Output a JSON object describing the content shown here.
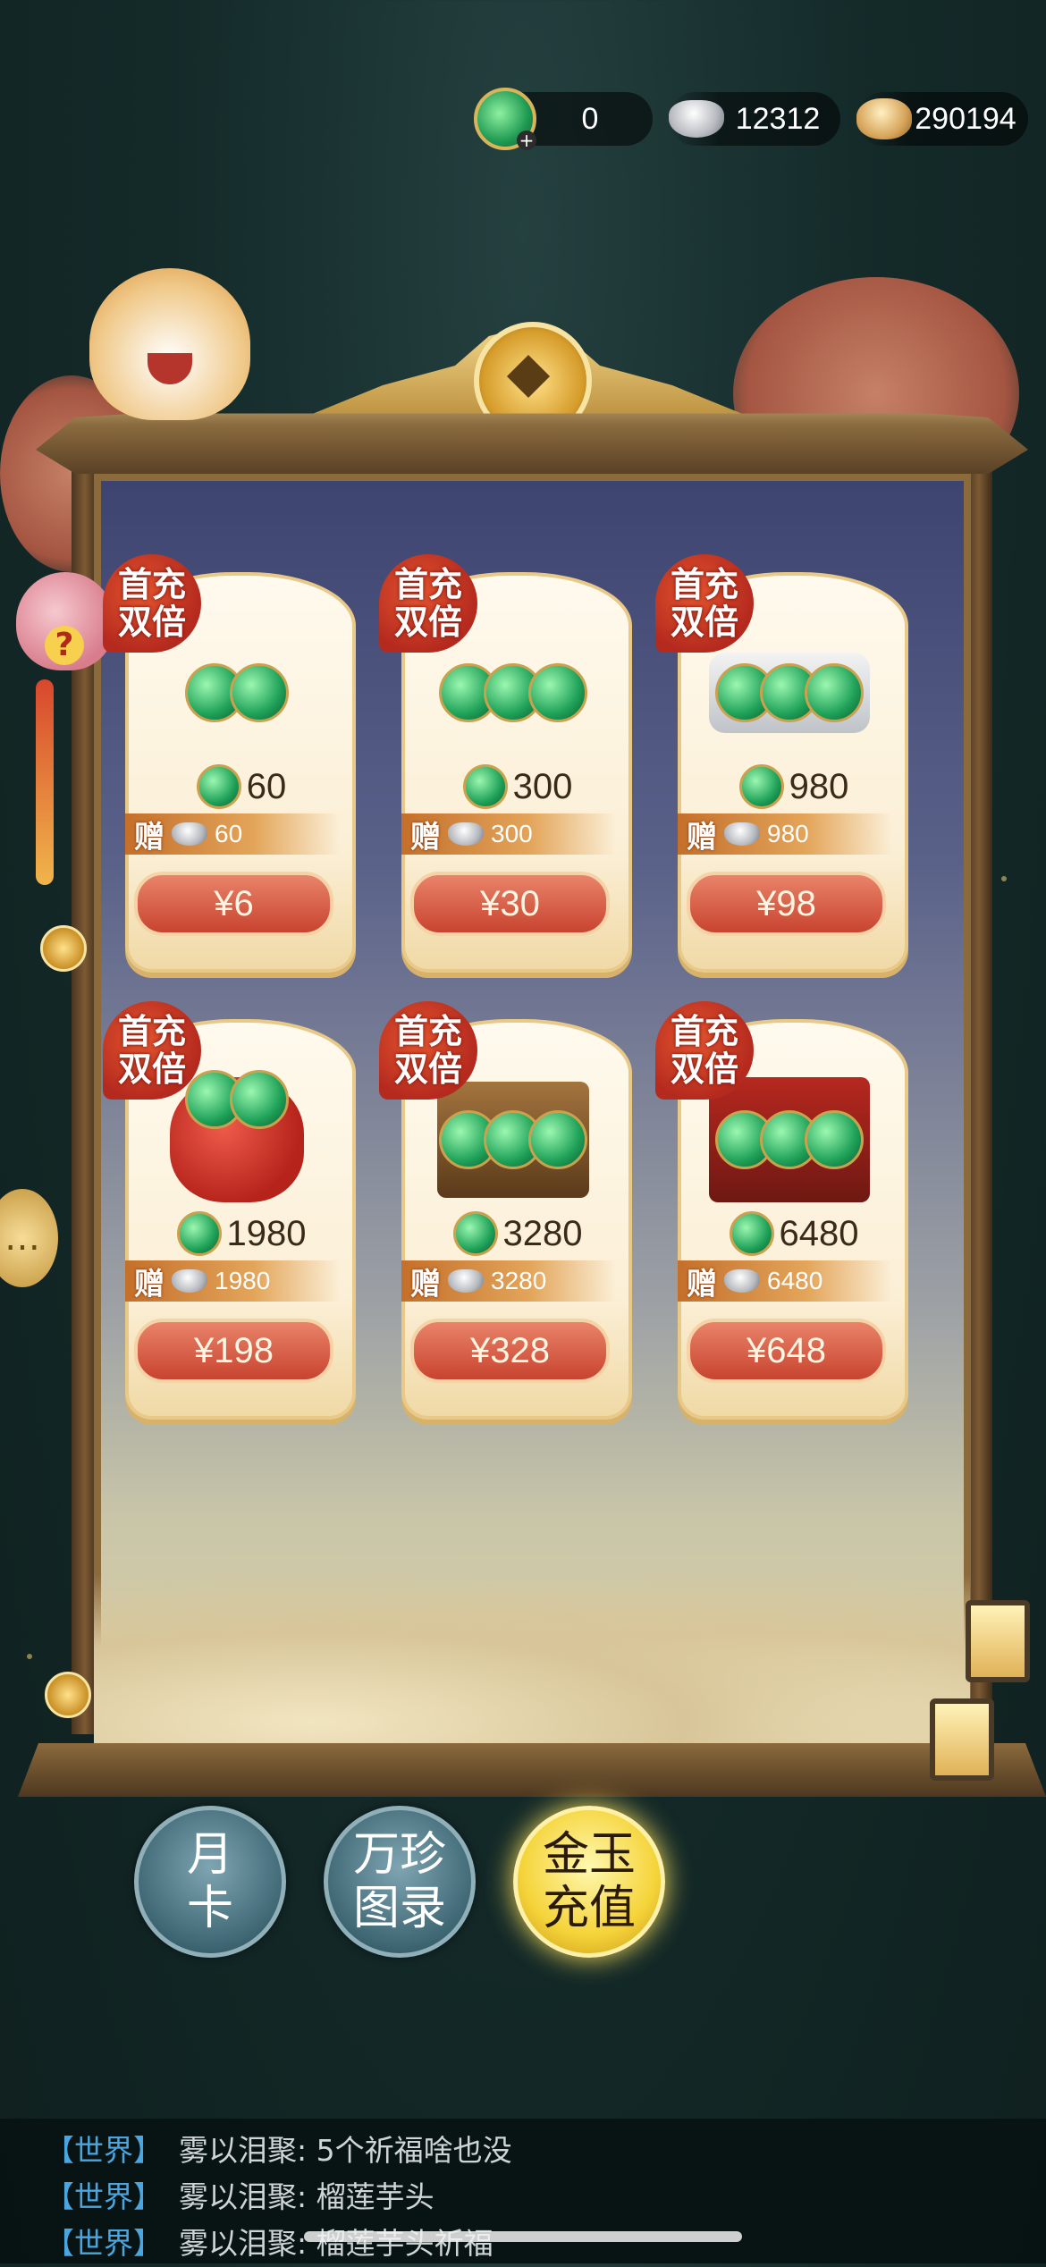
{
  "currencies": [
    {
      "icon": "jade-coin-icon",
      "value": "0",
      "has_plus": true
    },
    {
      "icon": "silver-ingot-icon",
      "value": "12312"
    },
    {
      "icon": "copper-coins-icon",
      "value": "290194"
    }
  ],
  "products": [
    {
      "badge": [
        "首充",
        "双倍"
      ],
      "art": "jade-pile-small-icon",
      "amount": "60",
      "bonus_label": "赠",
      "bonus": "60",
      "price": "¥6"
    },
    {
      "badge": [
        "首充",
        "双倍"
      ],
      "art": "jade-pile-medium-icon",
      "amount": "300",
      "bonus_label": "赠",
      "bonus": "300",
      "price": "¥30"
    },
    {
      "badge": [
        "首充",
        "双倍"
      ],
      "art": "jade-tray-icon",
      "amount": "980",
      "bonus_label": "赠",
      "bonus": "980",
      "price": "¥98"
    },
    {
      "badge": [
        "首充",
        "双倍"
      ],
      "art": "jade-bag-icon",
      "amount": "1980",
      "bonus_label": "赠",
      "bonus": "1980",
      "price": "¥198"
    },
    {
      "badge": [
        "首充",
        "双倍"
      ],
      "art": "jade-basket-icon",
      "amount": "3280",
      "bonus_label": "赠",
      "bonus": "3280",
      "price": "¥328"
    },
    {
      "badge": [
        "首充",
        "双倍"
      ],
      "art": "jade-chest-icon",
      "amount": "6480",
      "bonus_label": "赠",
      "bonus": "6480",
      "price": "¥648"
    }
  ],
  "tabs": [
    {
      "label": "月\n卡",
      "active": false
    },
    {
      "label": "万珍\n图录",
      "active": false
    },
    {
      "label": "金玉\n充值",
      "active": true
    }
  ],
  "chat": [
    {
      "channel": "【世界】",
      "text": "雾以泪聚: 5个祈福啥也没"
    },
    {
      "channel": "【世界】",
      "text": "雾以泪聚: 榴莲芋头"
    },
    {
      "channel": "【世界】",
      "text": "雾以泪聚: 榴莲芋头祈福"
    }
  ],
  "help_icon": "?",
  "colors": {
    "accent": "#f5d43a",
    "price": "#c8442f",
    "badge": "#b52a1e",
    "chat_channel": "#4aa6e0"
  }
}
